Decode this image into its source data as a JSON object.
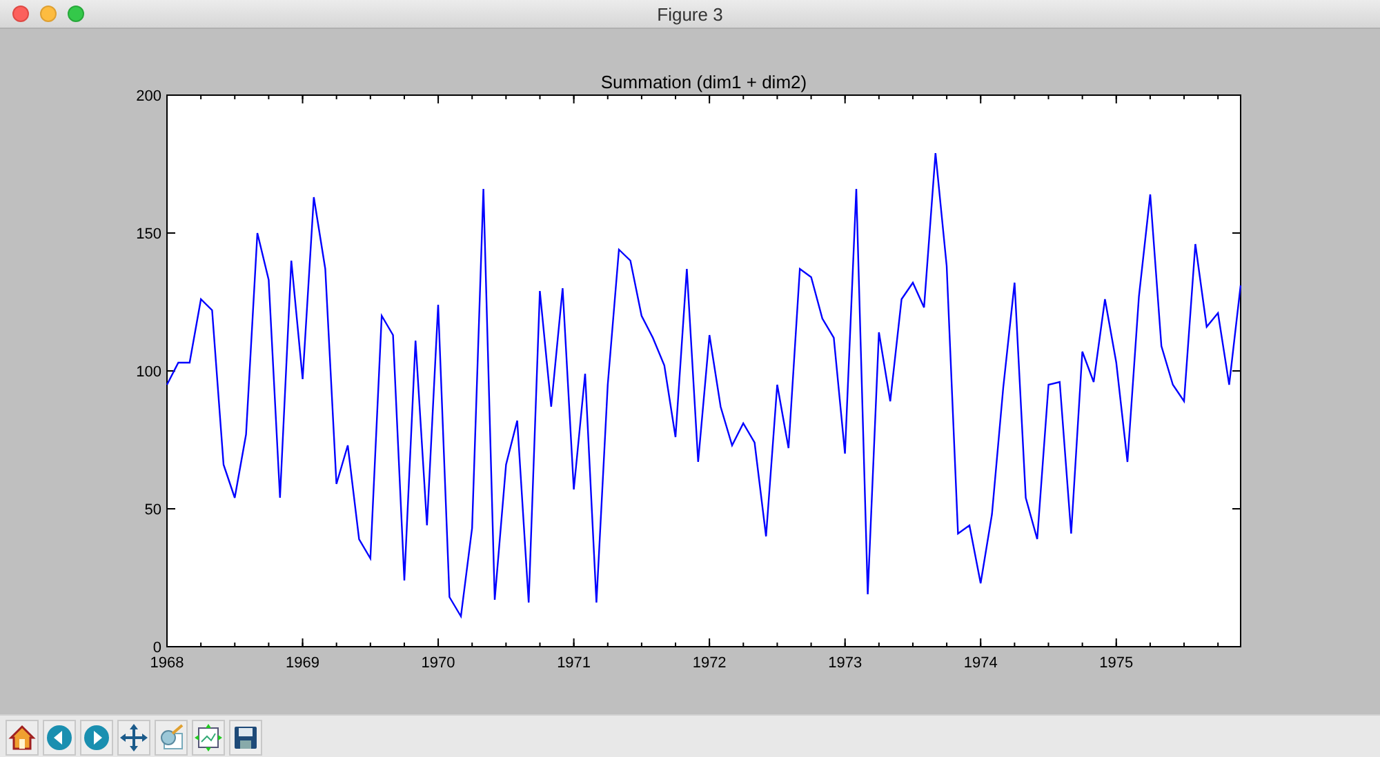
{
  "window": {
    "title": "Figure 3"
  },
  "figure": {
    "chart_data": {
      "type": "line",
      "title": "Summation (dim1 + dim2)",
      "x": [
        1968,
        1968.083,
        1968.167,
        1968.25,
        1968.333,
        1968.417,
        1968.5,
        1968.583,
        1968.667,
        1968.75,
        1968.833,
        1968.917,
        1969,
        1969.083,
        1969.167,
        1969.25,
        1969.333,
        1969.417,
        1969.5,
        1969.583,
        1969.667,
        1969.75,
        1969.833,
        1969.917,
        1970,
        1970.083,
        1970.167,
        1970.25,
        1970.333,
        1970.417,
        1970.5,
        1970.583,
        1970.667,
        1970.75,
        1970.833,
        1970.917,
        1971,
        1971.083,
        1971.167,
        1971.25,
        1971.333,
        1971.417,
        1971.5,
        1971.583,
        1971.667,
        1971.75,
        1971.833,
        1971.917,
        1972,
        1972.083,
        1972.167,
        1972.25,
        1972.333,
        1972.417,
        1972.5,
        1972.583,
        1972.667,
        1972.75,
        1972.833,
        1972.917,
        1973,
        1973.083,
        1973.167,
        1973.25,
        1973.333,
        1973.417,
        1973.5,
        1973.583,
        1973.667,
        1973.75,
        1973.833,
        1973.917,
        1974,
        1974.083,
        1974.167,
        1974.25,
        1974.333,
        1974.417,
        1974.5,
        1974.583,
        1974.667,
        1974.75,
        1974.833,
        1974.917,
        1975,
        1975.083,
        1975.167,
        1975.25,
        1975.333,
        1975.417,
        1975.5,
        1975.583,
        1975.667,
        1975.75,
        1975.833,
        1975.917
      ],
      "series": [
        {
          "color": "#0000ff",
          "values": [
            95,
            103,
            103,
            126,
            122,
            66,
            54,
            77,
            150,
            133,
            54,
            140,
            97,
            163,
            137,
            59,
            73,
            39,
            32,
            120,
            113,
            24,
            111,
            44,
            124,
            18,
            11,
            43,
            166,
            17,
            66,
            82,
            16,
            129,
            87,
            130,
            57,
            99,
            16,
            95,
            144,
            140,
            120,
            112,
            102,
            76,
            137,
            67,
            113,
            87,
            73,
            81,
            74,
            40,
            95,
            72,
            137,
            134,
            119,
            112,
            70,
            166,
            19,
            114,
            89,
            126,
            132,
            123,
            179,
            138,
            41,
            44,
            23,
            48,
            94,
            132,
            54,
            39,
            95,
            96,
            41,
            107,
            96,
            126,
            103,
            67,
            127,
            164,
            109,
            95,
            89,
            146,
            116,
            121,
            95,
            131
          ]
        }
      ],
      "xlim": [
        1968,
        1975.917
      ],
      "ylim": [
        0,
        200
      ],
      "xticks": [
        {
          "value": 1968,
          "label": "1968"
        },
        {
          "value": 1969,
          "label": "1969"
        },
        {
          "value": 1970,
          "label": "1970"
        },
        {
          "value": 1971,
          "label": "1971"
        },
        {
          "value": 1972,
          "label": "1972"
        },
        {
          "value": 1973,
          "label": "1973"
        },
        {
          "value": 1974,
          "label": "1974"
        },
        {
          "value": 1975,
          "label": "1975"
        }
      ],
      "yticks": [
        {
          "value": 0,
          "label": "0"
        },
        {
          "value": 50,
          "label": "50"
        },
        {
          "value": 100,
          "label": "100"
        },
        {
          "value": 150,
          "label": "150"
        },
        {
          "value": 200,
          "label": "200"
        }
      ]
    }
  },
  "toolbar": [
    {
      "kind": "home"
    },
    {
      "kind": "back"
    },
    {
      "kind": "forward"
    },
    {
      "kind": "pan"
    },
    {
      "kind": "zoom"
    },
    {
      "kind": "subplots"
    },
    {
      "kind": "save"
    }
  ]
}
